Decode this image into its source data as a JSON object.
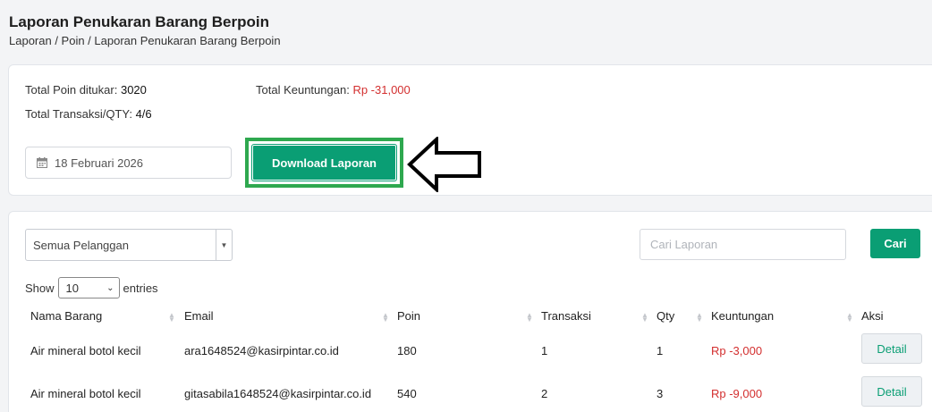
{
  "header": {
    "title": "Laporan Penukaran Barang Berpoin",
    "breadcrumb": "Laporan / Poin / Laporan Penukaran Barang Berpoin"
  },
  "summary": {
    "total_poin_label": "Total Poin ditukar:",
    "total_poin_value": "3020",
    "total_transaksi_label": "Total Transaksi/QTY:",
    "total_transaksi_value": "4/6",
    "total_keuntungan_label": "Total Keuntungan:",
    "total_keuntungan_value": "Rp -31,000",
    "date_value": "18 Februari 2026",
    "download_label": "Download Laporan"
  },
  "filters": {
    "pelanggan_selected": "Semua Pelanggan",
    "search_placeholder": "Cari Laporan",
    "search_button": "Cari",
    "show_label": "Show",
    "entries_value": "10",
    "entries_label": "entries"
  },
  "table": {
    "columns": [
      "Nama Barang",
      "Email",
      "Poin",
      "Transaksi",
      "Qty",
      "Keuntungan",
      "Aksi"
    ],
    "rows": [
      {
        "nama_barang": "Air mineral botol kecil",
        "email": "ara1648524@kasirpintar.co.id",
        "poin": "180",
        "transaksi": "1",
        "qty": "1",
        "keuntungan": "Rp -3,000",
        "aksi": "Detail"
      },
      {
        "nama_barang": "Air mineral botol kecil",
        "email": "gitasabila1648524@kasirpintar.co.id",
        "poin": "540",
        "transaksi": "2",
        "qty": "3",
        "keuntungan": "Rp -9,000",
        "aksi": "Detail"
      }
    ]
  },
  "colors": {
    "primary": "#0a9e74",
    "negative": "#d32f2f",
    "highlight": "#2ea84f"
  },
  "icons": {
    "date": "calendar-icon",
    "annotation": "arrow-left-icon"
  }
}
